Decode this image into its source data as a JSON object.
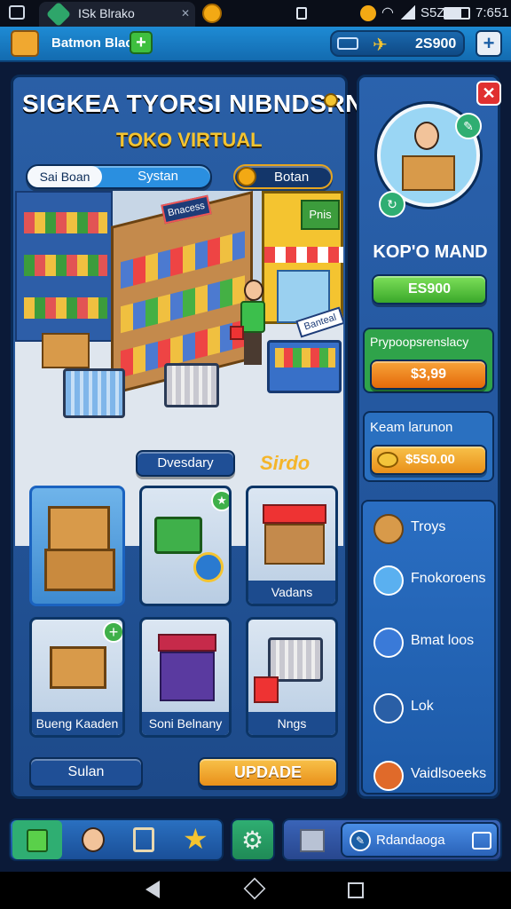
{
  "status_bar": {
    "tab_title": "ISk Blrako",
    "signal_text": "S5Z",
    "time": "7:651"
  },
  "top_bar": {
    "profile_name": "Batmon Blace",
    "currency_value": "2S900"
  },
  "main_panel": {
    "title": "SIGKEA TYORSI NIBNDSRNL",
    "subtitle": "TOKO VIRTUAL",
    "tabs": [
      "Sai Boan",
      "Systan"
    ],
    "coin_button_label": "Botan",
    "shop_sign": "Bnacess",
    "store_sign": "Pnis",
    "banner": "Banteal",
    "section_label": "Dvesdary",
    "section_tag": "Sirdo",
    "cards": [
      {
        "label": ""
      },
      {
        "label": ""
      },
      {
        "label": "Vadans"
      },
      {
        "label": "Bueng Kaaden"
      },
      {
        "label": "Soni Belnany"
      },
      {
        "label": "Nngs"
      }
    ],
    "left_button_label": "Sulan",
    "update_button_label": "UPDADE"
  },
  "right_panel": {
    "player_name": "KOP'O MAND",
    "green_button_value": "ES900",
    "offer_title": "Prypoopsrenslacy",
    "offer_price": "$3,99",
    "bonus_title": "Keam larunon",
    "bonus_value": "$5S0.00",
    "menu_items": [
      "Troys",
      "Fnokoroens",
      "Bmat loos",
      "Lok",
      "Vaidlsoeeks"
    ]
  },
  "bottom_nav": {
    "right_label": "Rdandaoga"
  },
  "colors": {
    "panel_blue": "#1d4a8a",
    "green": "#4cbf2c",
    "orange": "#f28a12",
    "gold": "#f4b52a",
    "title_yellow": "#f4c430"
  }
}
